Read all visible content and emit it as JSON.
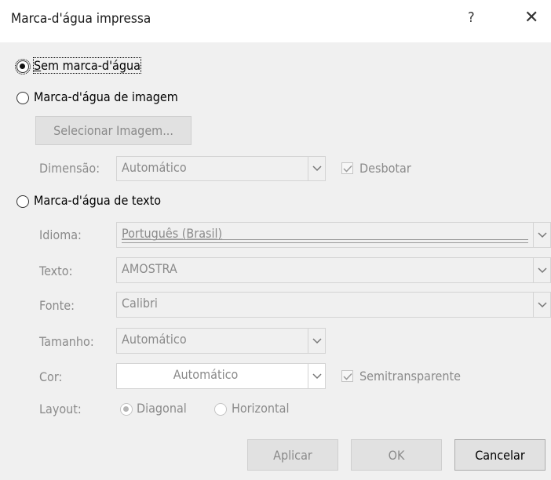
{
  "window": {
    "title": "Marca-d'água impressa",
    "help_glyph": "?",
    "close_glyph": "✕"
  },
  "options": {
    "none_label": "Sem marca-d'água",
    "picture_label": "Marca-d'água de imagem",
    "text_label": "Marca-d'água de texto",
    "selected": "none"
  },
  "picture": {
    "select_button": "Selecionar Imagem...",
    "scale_label": "Dimensão:",
    "scale_value": "Automático",
    "washout_label": "Desbotar",
    "washout_checked": true
  },
  "text_wm": {
    "language_label": "Idioma:",
    "language_value": "Português (Brasil)",
    "text_label": "Texto:",
    "text_value": "AMOSTRA",
    "font_label": "Fonte:",
    "font_value": "Calibri",
    "size_label": "Tamanho:",
    "size_value": "Automático",
    "color_label": "Cor:",
    "color_value": "Automático",
    "semitransparent_label": "Semitransparente",
    "semitransparent_checked": true,
    "layout_label": "Layout:",
    "layout_diagonal": "Diagonal",
    "layout_horizontal": "Horizontal",
    "layout_selected": "diagonal"
  },
  "buttons": {
    "apply": "Aplicar",
    "ok": "OK",
    "cancel": "Cancelar"
  }
}
